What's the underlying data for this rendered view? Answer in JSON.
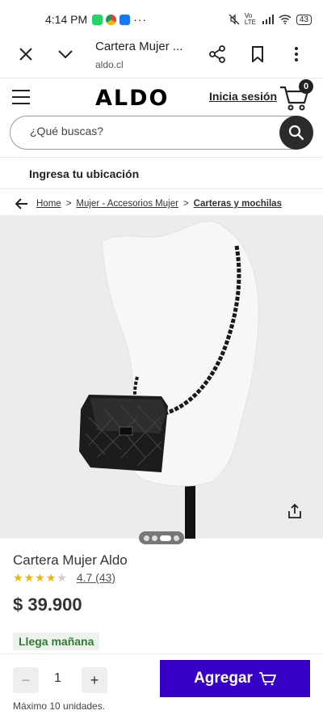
{
  "status_bar": {
    "time": "4:14 PM",
    "battery": "43",
    "network_label": "Vo LTE"
  },
  "browser": {
    "page_title": "Cartera Mujer ...",
    "url": "aldo.cl"
  },
  "header": {
    "logo": "ALDO",
    "login_label": "Inicia sesión",
    "cart_count": "0"
  },
  "search": {
    "placeholder": "¿Qué buscas?"
  },
  "location": {
    "label": "Ingresa tu ubicación"
  },
  "breadcrumb": {
    "items": [
      "Home",
      "Mujer - Accesorios Mujer",
      "Carteras y mochilas"
    ],
    "separator": ">"
  },
  "product": {
    "name": "Cartera Mujer Aldo",
    "rating": 4,
    "rating_text": "4.7 (43)",
    "price": "$ 39.900",
    "delivery": "Llega mañana",
    "carousel_slides": 4,
    "carousel_active": 2
  },
  "purchase": {
    "minus": "−",
    "plus": "+",
    "quantity": "1",
    "add_label": "Agregar",
    "max_note": "Máximo 10 unidades."
  },
  "colors": {
    "accent": "#3700c7",
    "star": "#f1b400",
    "delivery_green": "#2e7d32"
  }
}
